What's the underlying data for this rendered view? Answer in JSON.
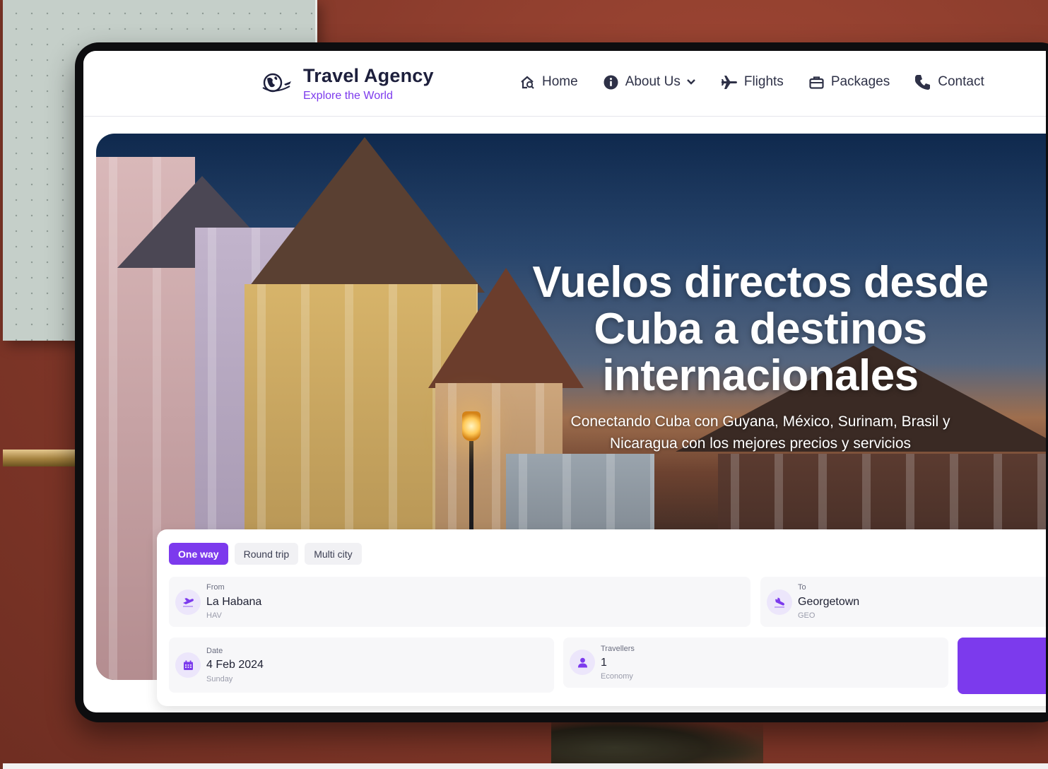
{
  "brand": {
    "name": "Travel Agency",
    "tagline": "Explore the World",
    "logo_icon": "globe-plane-icon"
  },
  "nav": {
    "items": [
      {
        "label": "Home",
        "icon": "home-search-icon"
      },
      {
        "label": "About Us",
        "icon": "info-icon",
        "has_dropdown": true
      },
      {
        "label": "Flights",
        "icon": "plane-icon"
      },
      {
        "label": "Packages",
        "icon": "briefcase-icon"
      },
      {
        "label": "Contact",
        "icon": "phone-icon"
      }
    ]
  },
  "hero": {
    "title_lines": [
      "Vuelos directos desde",
      "Cuba a destinos",
      "internacionales"
    ],
    "subtitle_lines": [
      "Conectando Cuba con Guyana, México, Surinam, Brasil y",
      "Nicaragua con los mejores precios y servicios"
    ]
  },
  "search": {
    "tabs": [
      {
        "label": "One way",
        "active": true
      },
      {
        "label": "Round trip",
        "active": false
      },
      {
        "label": "Multi city",
        "active": false
      }
    ],
    "from": {
      "label": "From",
      "value": "La Habana",
      "code": "HAV",
      "icon": "plane-takeoff-icon"
    },
    "to": {
      "label": "To",
      "value": "Georgetown",
      "code": "GEO",
      "icon": "plane-landing-icon"
    },
    "date": {
      "label": "Date",
      "value": "4 Feb 2024",
      "day": "Sunday",
      "icon": "calendar-icon"
    },
    "travellers": {
      "label": "Travellers",
      "value": "1",
      "class": "Economy",
      "icon": "user-icon"
    }
  },
  "colors": {
    "accent": "#7c3aed",
    "brand_dark": "#1d1f3c",
    "field_bg": "#f7f7f9"
  }
}
